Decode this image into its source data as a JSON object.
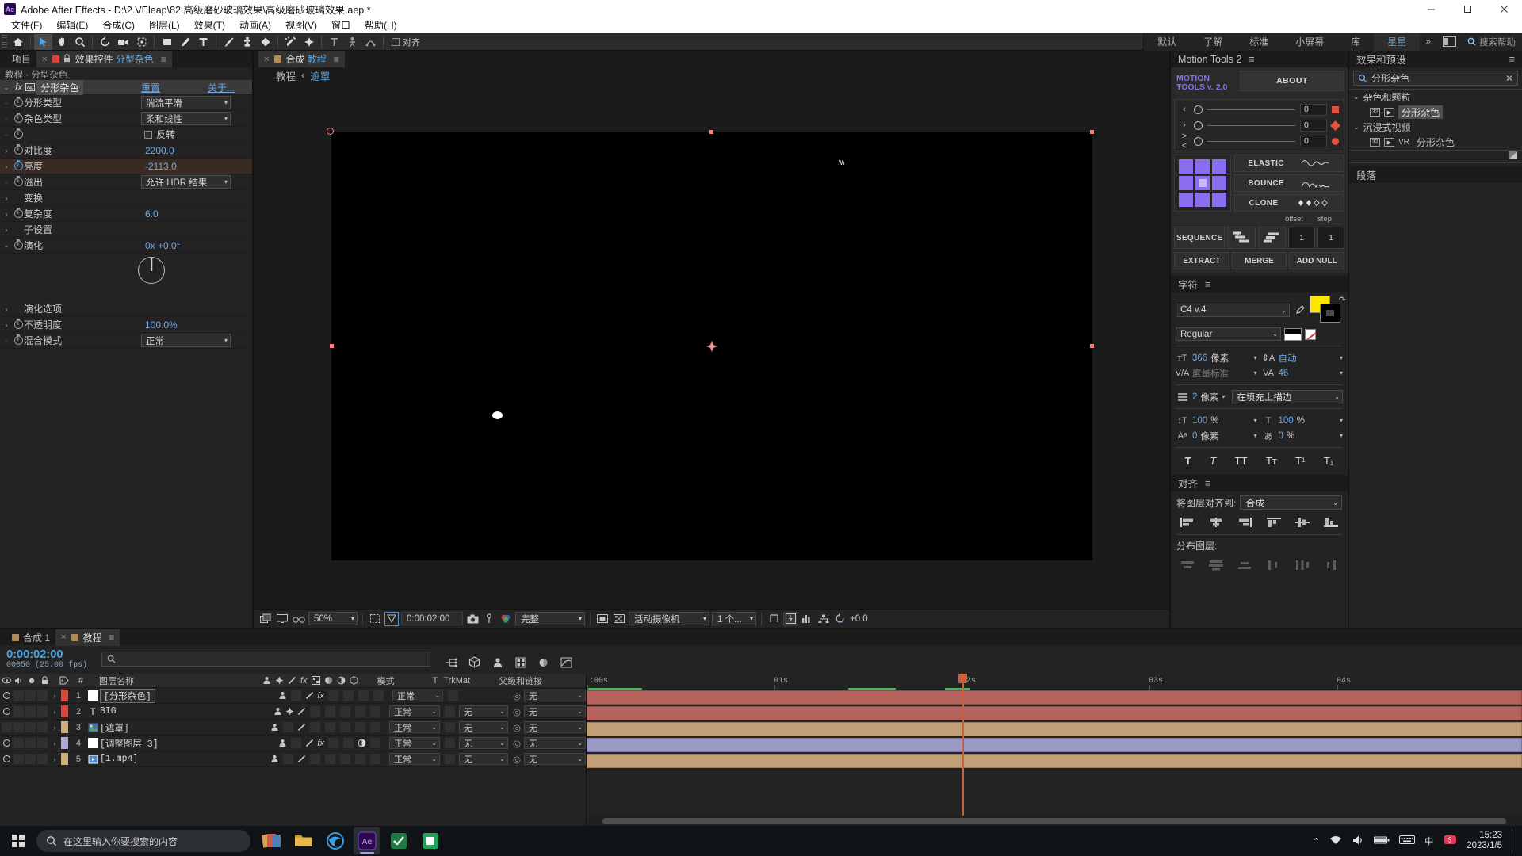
{
  "titlebar": {
    "app_badge": "Ae",
    "title": "Adobe After Effects - D:\\2.VEleap\\82.高级磨砂玻璃效果\\高级磨砂玻璃效果.aep *",
    "minimize": "—",
    "maximize": "▢",
    "close": "✕"
  },
  "menubar": {
    "items": [
      {
        "label": "文件(F)"
      },
      {
        "label": "编辑(E)"
      },
      {
        "label": "合成(C)"
      },
      {
        "label": "图层(L)"
      },
      {
        "label": "效果(T)"
      },
      {
        "label": "动画(A)"
      },
      {
        "label": "视图(V)"
      },
      {
        "label": "窗口"
      },
      {
        "label": "帮助(H)"
      }
    ]
  },
  "toolbar": {
    "align_label": "对齐",
    "workspaces": [
      {
        "label": "默认",
        "selected": false
      },
      {
        "label": "了解",
        "selected": false
      },
      {
        "label": "标准",
        "selected": false
      },
      {
        "label": "小屏幕",
        "selected": false
      },
      {
        "label": "库",
        "selected": false
      },
      {
        "label": "星星",
        "selected": true
      }
    ],
    "workspace_more": "»",
    "search_placeholder": "搜索帮助"
  },
  "effect_controls": {
    "tabs": [
      {
        "label": "项目",
        "active": false
      },
      {
        "label": "效果控件 分型杂色",
        "active": true
      }
    ],
    "tab_close": "×",
    "breadcrumb": "教程 · 分型杂色",
    "effect_name": "分形杂色",
    "reset_label": "重置",
    "about_label": "关于...",
    "rows": [
      {
        "name": "分形类型",
        "type": "dropdown",
        "value": "湍流平滑",
        "stopwatch": true,
        "twirl": false
      },
      {
        "name": "杂色类型",
        "type": "dropdown",
        "value": "柔和线性",
        "stopwatch": true,
        "twirl": false
      },
      {
        "name": "反转",
        "type": "checkbox",
        "value": "反转",
        "checked": false,
        "stopwatch": true,
        "twirl": false
      },
      {
        "name": "对比度",
        "type": "number",
        "value": "2200.0",
        "stopwatch": true,
        "twirl": true
      },
      {
        "name": "亮度",
        "type": "number",
        "value": "-2113.0",
        "stopwatch": true,
        "stopwatch_on": true,
        "twirl": true,
        "highlight": true
      },
      {
        "name": "溢出",
        "type": "dropdown",
        "value": "允许 HDR 结果",
        "stopwatch": true,
        "twirl": false
      },
      {
        "name": "变换",
        "type": "group",
        "value": "",
        "stopwatch": false,
        "twirl": true
      },
      {
        "name": "复杂度",
        "type": "number",
        "value": "6.0",
        "stopwatch": true,
        "twirl": true
      },
      {
        "name": "子设置",
        "type": "group",
        "value": "",
        "stopwatch": false,
        "twirl": true
      },
      {
        "name": "演化",
        "type": "angle",
        "value": "0x +0.0°",
        "stopwatch": true,
        "twirl": true,
        "expanded": true
      },
      {
        "name": "演化选项",
        "type": "group",
        "value": "",
        "stopwatch": false,
        "twirl": true
      },
      {
        "name": "不透明度",
        "type": "number",
        "value": "100.0%",
        "stopwatch": true,
        "twirl": true
      },
      {
        "name": "混合模式",
        "type": "dropdown",
        "value": "正常",
        "stopwatch": true,
        "twirl": false
      }
    ]
  },
  "composition": {
    "tab_label": "合成 教程",
    "tab_close": "×",
    "breadcrumb": [
      {
        "label": "教程",
        "active": false
      },
      {
        "label": "遮罩",
        "active": true
      }
    ],
    "breadcrumb_sep": "‹",
    "viewer_bar": {
      "zoom": "50%",
      "timecode": "0:00:02:00",
      "resolution": "完整",
      "camera": "活动摄像机",
      "views": "1 个...",
      "exposure": "+0.0"
    }
  },
  "motion_tools": {
    "panel_title": "Motion Tools 2",
    "logo_line1": "MOTION",
    "logo_line2": "TOOLS v. 2.0",
    "about": "ABOUT",
    "sliders": [
      {
        "icon": "‹",
        "value": "0",
        "shape": "square",
        "color": "#e2523c"
      },
      {
        "icon": "›",
        "value": "0",
        "shape": "diamond",
        "color": "#e2523c"
      },
      {
        "icon": "><",
        "value": "0",
        "shape": "circle",
        "color": "#e2523c"
      }
    ],
    "elastic": "ELASTIC",
    "bounce": "BOUNCE",
    "clone": "CLONE",
    "offset_label": "offset",
    "step_label": "step",
    "offset_value": "1",
    "step_value": "1",
    "sequence": "SEQUENCE",
    "extract": "EXTRACT",
    "merge": "MERGE",
    "add_null": "ADD NULL",
    "grid_accent": "#8b6ef0"
  },
  "character": {
    "panel_title": "字符",
    "font_family": "C4 v.4",
    "font_style": "Regular",
    "font_size": "366",
    "font_size_unit": "像素",
    "leading": "自动",
    "kerning": "度量标准",
    "tracking": "46",
    "stroke_width": "2",
    "stroke_width_unit": "像素",
    "stroke_mode": "在填充上描边",
    "vertical_scale": "100",
    "horizontal_scale": "100",
    "baseline_shift": "0",
    "baseline_unit": "像素",
    "tsume": "0",
    "percent": "%",
    "fill_color": "#ffe400",
    "stroke_color": "#000000",
    "styles": [
      "T",
      "T",
      "TT",
      "Tᴛ",
      "T¹",
      "T₁"
    ]
  },
  "align": {
    "panel_title": "对齐",
    "align_to_label": "将图层对齐到:",
    "align_to_value": "合成",
    "distribute_label": "分布图层:"
  },
  "effects_presets": {
    "panel_title": "效果和预设",
    "search_value": "分形杂色",
    "clear": "✕",
    "groups": [
      {
        "label": "杂色和颗粒",
        "items": [
          {
            "label": "分形杂色",
            "selected": true,
            "vr": false
          }
        ]
      },
      {
        "label": "沉浸式视频",
        "items": [
          {
            "label": "分形杂色",
            "selected": false,
            "vr": true,
            "vr_label": "VR"
          }
        ]
      }
    ],
    "paragraph_title": "段落"
  },
  "timeline": {
    "tabs": [
      {
        "label": "合成 1",
        "active": false,
        "color": "#b08a5a"
      },
      {
        "label": "教程",
        "active": true,
        "color": "#b08a5a"
      }
    ],
    "tab_close": "×",
    "current_time": "0:00:02:00",
    "frame_info": "00050 (25.00 fps)",
    "search_placeholder": "",
    "columns": [
      "#",
      "图层名称",
      "模式",
      "T",
      "TrkMat",
      "父级和链接"
    ],
    "layers": [
      {
        "index": "1",
        "name": "[分形杂色]",
        "color": "#d8463c",
        "mode": "正常",
        "trkmat": "",
        "parent": "无",
        "type": "solid",
        "visible": true,
        "selected": true,
        "has_fx": true,
        "bar_color": "#b5635c"
      },
      {
        "index": "2",
        "name": "BIG",
        "color": "#d8463c",
        "mode": "正常",
        "trkmat": "无",
        "parent": "无",
        "type": "text",
        "visible": true,
        "selected": false,
        "has_fx": false,
        "bar_color": "#b5635c"
      },
      {
        "index": "3",
        "name": "[遮罩]",
        "color": "#d2ac7a",
        "mode": "正常",
        "trkmat": "无",
        "parent": "无",
        "type": "image",
        "visible": false,
        "selected": false,
        "has_fx": false,
        "bar_color": "#c2a077"
      },
      {
        "index": "4",
        "name": "[调整图层 3]",
        "color": "#a9a8d8",
        "mode": "正常",
        "trkmat": "无",
        "parent": "无",
        "type": "adjust",
        "visible": true,
        "selected": false,
        "has_fx": true,
        "bar_color": "#9b9ac6"
      },
      {
        "index": "5",
        "name": "[1.mp4]",
        "color": "#d2ac7a",
        "mode": "正常",
        "trkmat": "无",
        "parent": "无",
        "type": "video",
        "visible": true,
        "selected": false,
        "has_fx": false,
        "bar_color": "#c2a077"
      }
    ],
    "ruler_ticks": [
      {
        "label": ":00s",
        "pos": 0
      },
      {
        "label": "01s",
        "pos": 0.202
      },
      {
        "label": "02s",
        "pos": 0.404
      },
      {
        "label": "03s",
        "pos": 0.606
      },
      {
        "label": "04s",
        "pos": 0.808
      }
    ],
    "playhead_pos": 0.404
  },
  "taskbar": {
    "search_placeholder": "在这里输入你要搜索的内容",
    "clock_time": "15:23",
    "clock_date": "2023/1/5",
    "apps": [
      {
        "name": "photos-app",
        "color": "#d8a050"
      },
      {
        "name": "folder-app",
        "color": "#e8b64a"
      },
      {
        "name": "edge-app",
        "color": "#3c9ae0"
      },
      {
        "name": "after-effects-app",
        "color": "#9b7de8",
        "active": true
      },
      {
        "name": "green-app",
        "color": "#3fa860"
      },
      {
        "name": "green-app-2",
        "color": "#4fbf6f"
      }
    ]
  }
}
